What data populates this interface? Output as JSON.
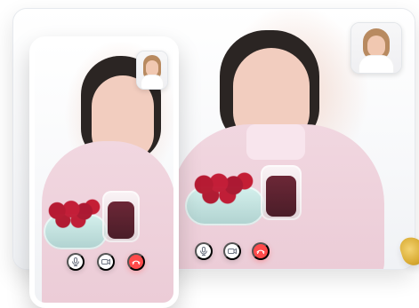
{
  "desktop": {
    "controls": [
      {
        "name": "mic",
        "icon": "microphone-icon"
      },
      {
        "name": "camera",
        "icon": "video-camera-icon"
      },
      {
        "name": "end_call",
        "icon": "phone-hangup-icon"
      }
    ]
  },
  "mobile": {
    "controls": [
      {
        "name": "mic",
        "icon": "microphone-icon"
      },
      {
        "name": "camera",
        "icon": "video-camera-icon"
      },
      {
        "name": "end_call",
        "icon": "phone-hangup-icon"
      }
    ]
  },
  "colors": {
    "end_call_red": "#ff4a4a",
    "frame_border": "#e6e9ee",
    "control_icon_gray": "#6b7280"
  }
}
